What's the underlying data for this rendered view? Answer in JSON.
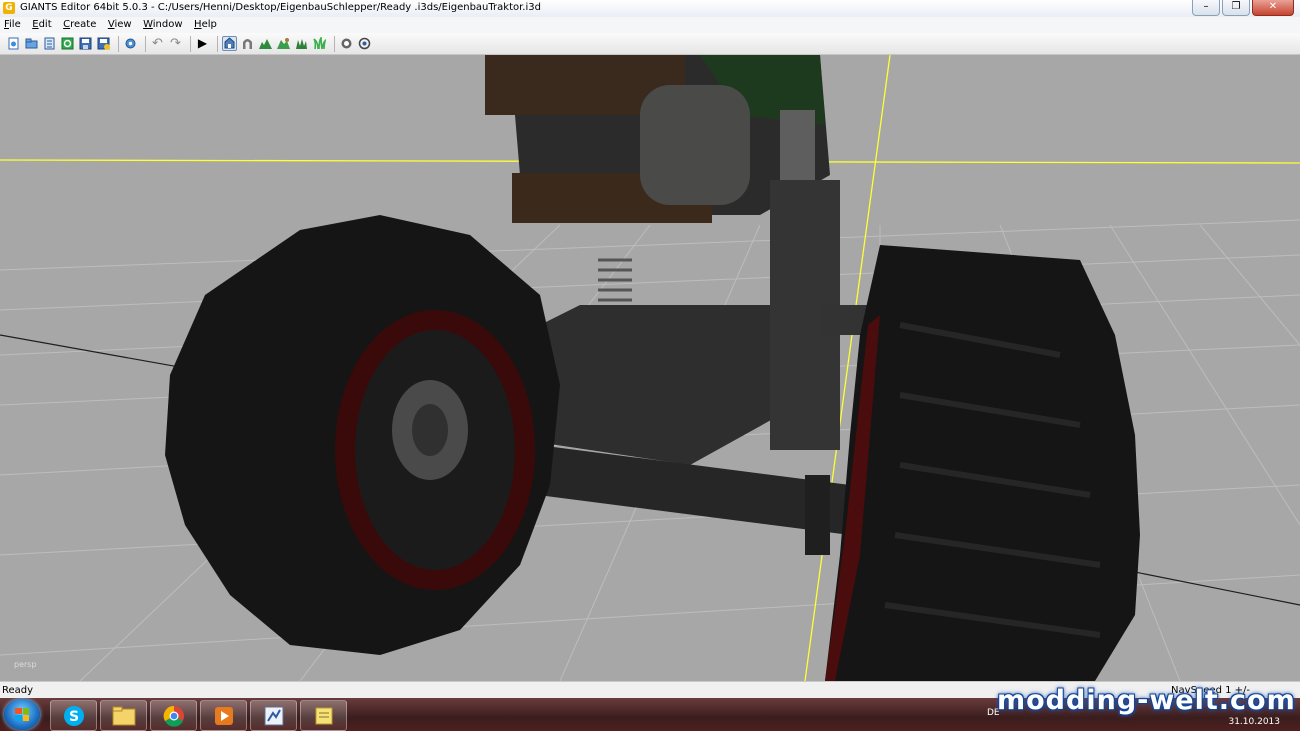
{
  "window": {
    "title": "GIANTS Editor 64bit 5.0.3 - C:/Users/Henni/Desktop/EigenbauSchlepper/Ready .i3ds/EigenbauTraktor.i3d",
    "app_icon": "G",
    "minimize": "–",
    "maximize": "❐",
    "close": "✕"
  },
  "menu": [
    "File",
    "Edit",
    "Create",
    "View",
    "Window",
    "Help"
  ],
  "toolbar": {
    "icons": [
      "new-scene-icon",
      "open-icon",
      "import-icon",
      "refresh-icon",
      "save-icon",
      "save-as-icon",
      "settings-icon",
      "undo-icon",
      "redo-icon",
      "play-icon",
      "select-mode-icon",
      "move-mode-icon",
      "terrain-sculpt-icon",
      "terrain-paint-icon",
      "foliage-paint-icon",
      "foliage-grass-icon",
      "render-toggle-icon",
      "wireframe-toggle-icon"
    ],
    "glyphs": {
      "play": "▶",
      "undo": "↶",
      "redo": "↷"
    }
  },
  "viewport": {
    "camera_label": "persp",
    "background_color": "#a7a7a7",
    "axis_color": "#ffff33"
  },
  "status": {
    "text": "Ready",
    "nav_speed": "NavSpeed 1 +/-"
  },
  "taskbar": {
    "apps": [
      "skype-icon",
      "file-explorer-icon",
      "chrome-icon",
      "media-player-icon",
      "giants-editor-icon",
      "notes-icon"
    ],
    "language": "DE",
    "date": "31.10.2013"
  },
  "watermark": "modding-welt.com"
}
